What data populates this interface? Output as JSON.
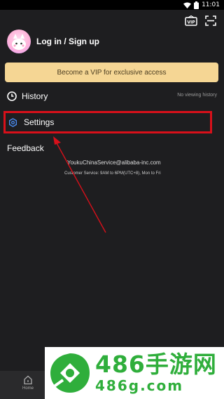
{
  "status_bar": {
    "time": "11:01"
  },
  "top_actions": [
    {
      "icon": "vip-card-icon",
      "label": "VIP"
    },
    {
      "icon": "scan-icon"
    }
  ],
  "account": {
    "login_label": "Log in / Sign up",
    "avatar_icon": "avatar-icon"
  },
  "vip_banner": {
    "text": "Become a VIP for exclusive access",
    "color": "#f5d694"
  },
  "menu": {
    "history": {
      "label": "History",
      "status": "No viewing history",
      "icon": "clock-icon"
    },
    "settings": {
      "label": "Settings",
      "icon": "settings-icon",
      "highlight_color": "#d8101a"
    },
    "feedback": {
      "label": "Feedback"
    }
  },
  "contact": {
    "email": "YoukuChinaService@alibaba-inc.com",
    "hours": "Customer Service: 9AM to 6PM(UTC+8), Mon to Fri"
  },
  "bottom_nav": {
    "home_label": "Home",
    "home_icon": "home-icon"
  },
  "watermark": {
    "title": "486手游网",
    "url": "486g.com",
    "color": "#2fae3b"
  }
}
